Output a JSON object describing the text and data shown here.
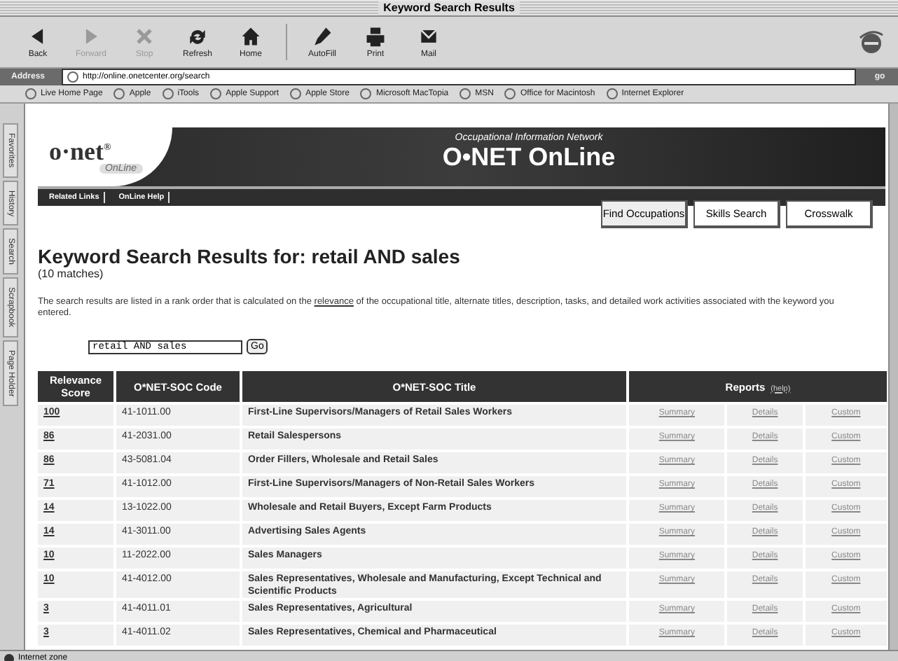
{
  "window": {
    "title": "Keyword Search Results"
  },
  "toolbar": [
    {
      "kind": "back",
      "label": "Back",
      "disabled": false
    },
    {
      "kind": "forward",
      "label": "Forward",
      "disabled": true
    },
    {
      "kind": "stop",
      "label": "Stop",
      "disabled": true
    },
    {
      "kind": "refresh",
      "label": "Refresh",
      "disabled": false
    },
    {
      "kind": "home",
      "label": "Home",
      "disabled": false
    },
    {
      "kind": "autofill",
      "label": "AutoFill",
      "disabled": false
    },
    {
      "kind": "print",
      "label": "Print",
      "disabled": false
    },
    {
      "kind": "mail",
      "label": "Mail",
      "disabled": false
    }
  ],
  "address_bar": {
    "label": "Address",
    "value": "http://online.onetcenter.org/search",
    "go": "go"
  },
  "favorites_bar": [
    "Live Home Page",
    "Apple",
    "iTools",
    "Apple Support",
    "Apple Store",
    "Microsoft MacTopia",
    "MSN",
    "Office for Macintosh",
    "Internet Explorer"
  ],
  "explorer_tabs": [
    "Favorites",
    "History",
    "Search",
    "Scrapbook",
    "Page Holder"
  ],
  "page": {
    "logo": {
      "text": "o·net",
      "mark": "®",
      "sub": "OnLine"
    },
    "banner_subtitle": "Occupational Information Network",
    "banner_title": "O•NET OnLine",
    "nav_links": [
      "Related Links",
      "OnLine Help"
    ],
    "nav_buttons": [
      "Find Occupations",
      "Skills Search",
      "Crosswalk"
    ],
    "heading": "Keyword Search Results for: retail AND sales",
    "match_count": "(10 matches)",
    "description": {
      "before": "The search results are listed in a rank order that is calculated on the",
      "link": "relevance",
      "after": "of the occupational title, alternate titles, description, tasks, and detailed work activities associated with the keyword you entered."
    },
    "search": {
      "value": "retail AND sales",
      "button": "Go"
    },
    "table": {
      "columns": [
        "Relevance Score",
        "O*NET-SOC Code",
        "O*NET-SOC Title",
        "Reports"
      ],
      "reports_help": "(help)",
      "rows": [
        {
          "score": "100",
          "code": "41-1011.00",
          "title": "First-Line Supervisors/Managers of Retail Sales Workers",
          "reports": [
            "Summary",
            "Details",
            "Custom"
          ]
        },
        {
          "score": "86",
          "code": "41-2031.00",
          "title": "Retail Salespersons",
          "reports": [
            "Summary",
            "Details",
            "Custom"
          ]
        },
        {
          "score": "86",
          "code": "43-5081.04",
          "title": "Order Fillers, Wholesale and Retail Sales",
          "reports": [
            "Summary",
            "Details",
            "Custom"
          ]
        },
        {
          "score": "71",
          "code": "41-1012.00",
          "title": "First-Line Supervisors/Managers of Non-Retail Sales Workers",
          "reports": [
            "Summary",
            "Details",
            "Custom"
          ]
        },
        {
          "score": "14",
          "code": "13-1022.00",
          "title": "Wholesale and Retail Buyers, Except Farm Products",
          "reports": [
            "Summary",
            "Details",
            "Custom"
          ]
        },
        {
          "score": "14",
          "code": "41-3011.00",
          "title": "Advertising Sales Agents",
          "reports": [
            "Summary",
            "Details",
            "Custom"
          ]
        },
        {
          "score": "10",
          "code": "11-2022.00",
          "title": "Sales Managers",
          "reports": [
            "Summary",
            "Details",
            "Custom"
          ]
        },
        {
          "score": "10",
          "code": "41-4012.00",
          "title": "Sales Representatives, Wholesale and Manufacturing, Except Technical and Scientific Products",
          "reports": [
            "Summary",
            "Details",
            "Custom"
          ]
        },
        {
          "score": "3",
          "code": "41-4011.01",
          "title": "Sales Representatives, Agricultural",
          "reports": [
            "Summary",
            "Details",
            "Custom"
          ]
        },
        {
          "score": "3",
          "code": "41-4011.02",
          "title": "Sales Representatives, Chemical and Pharmaceutical",
          "reports": [
            "Summary",
            "Details",
            "Custom"
          ]
        }
      ]
    }
  },
  "status_bar": {
    "text": "Internet zone"
  }
}
